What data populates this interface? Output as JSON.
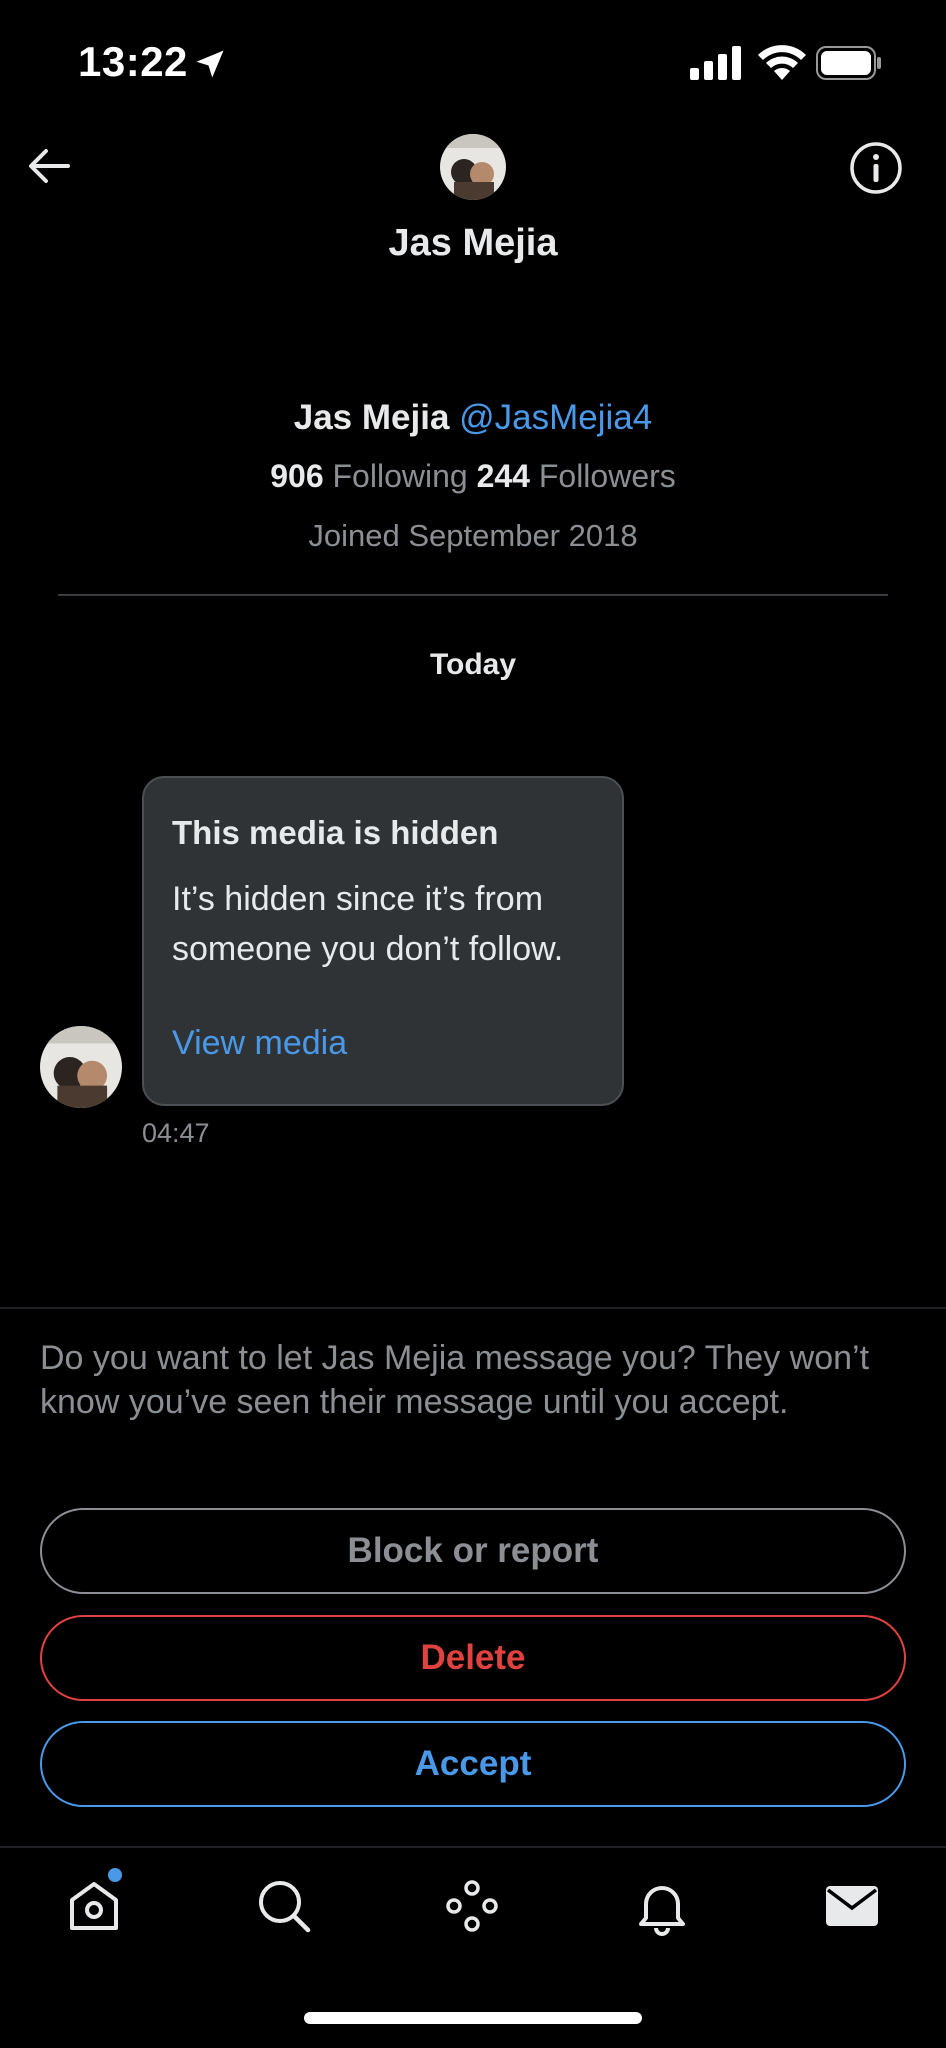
{
  "status_bar": {
    "time": "13:22"
  },
  "header": {
    "title": "Jas Mejia"
  },
  "profile": {
    "name": "Jas Mejia",
    "handle": "@JasMejia4",
    "following_count": "906",
    "following_label": "Following",
    "followers_count": "244",
    "followers_label": "Followers",
    "joined": "Joined September 2018"
  },
  "conversation": {
    "day_label": "Today",
    "message": {
      "title": "This media is hidden",
      "body": "It’s hidden since it’s from someone you don’t follow.",
      "link": "View media",
      "time": "04:47"
    }
  },
  "request": {
    "prompt": "Do you want to let Jas Mejia message you? They won’t know you’ve seen their message until you accept.",
    "block_label": "Block or report",
    "delete_label": "Delete",
    "accept_label": "Accept"
  },
  "tabs": [
    "home-icon",
    "search-icon",
    "spaces-icon",
    "notifications-icon",
    "messages-icon"
  ],
  "colors": {
    "accent": "#4a99e9",
    "danger": "#e0433f",
    "background": "#000000"
  }
}
